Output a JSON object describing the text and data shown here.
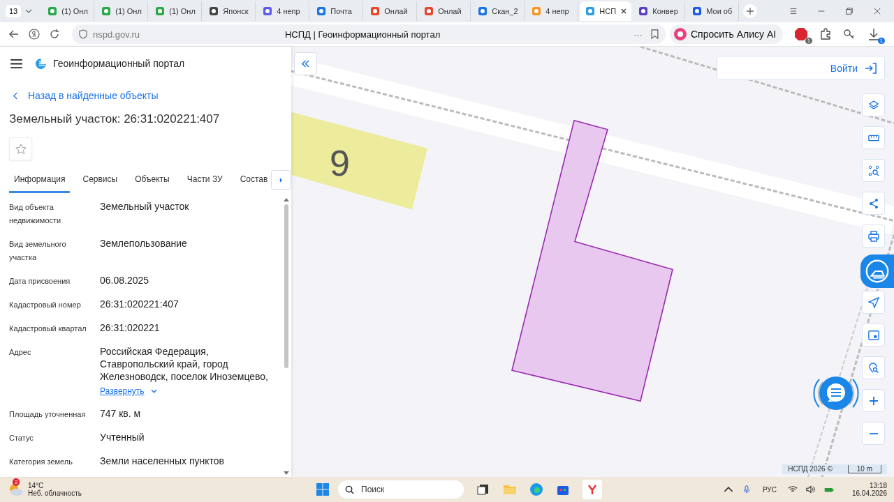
{
  "browser": {
    "tab_count": "13",
    "tabs": [
      {
        "title": "(1) Онл",
        "selected": false
      },
      {
        "title": "(1) Онл",
        "selected": false
      },
      {
        "title": "(1) Онл",
        "selected": false
      },
      {
        "title": "Японск",
        "selected": false
      },
      {
        "title": "4 непр",
        "selected": false
      },
      {
        "title": "Почта",
        "selected": false
      },
      {
        "title": "Онлай",
        "selected": false
      },
      {
        "title": "Онлай",
        "selected": false
      },
      {
        "title": "Скан_2",
        "selected": false
      },
      {
        "title": "4 непр",
        "selected": false
      },
      {
        "title": "НСП",
        "selected": true
      },
      {
        "title": "Конвер",
        "selected": false
      },
      {
        "title": "Мои об",
        "selected": false
      }
    ],
    "address": "nspd.gov.ru",
    "menu_dots": "···",
    "page_title": "НСПД | Геоинформационный портал",
    "alice": "Спросить Алису AI",
    "adblock_badge": "1",
    "download_badge": "1"
  },
  "portal": {
    "title": "Геоинформационный портал",
    "back_link": "Назад в найденные объекты",
    "heading": "Земельный участок: 26:31:020221:407",
    "tabs": [
      {
        "label": "Информация",
        "selected": true
      },
      {
        "label": "Сервисы",
        "selected": false
      },
      {
        "label": "Объекты",
        "selected": false
      },
      {
        "label": "Части ЗУ",
        "selected": false
      },
      {
        "label": "Состав",
        "selected": false
      }
    ],
    "fields": [
      {
        "label": "Вид объекта недвижимости",
        "value": "Земельный участок"
      },
      {
        "label": "Вид земельного участка",
        "value": "Землепользование"
      },
      {
        "label": "Дата присвоения",
        "value": "06.08.2025"
      },
      {
        "label": "Кадастровый номер",
        "value": "26:31:020221:407"
      },
      {
        "label": "Кадастровый квартал",
        "value": "26:31:020221"
      },
      {
        "label": "Адрес",
        "value": "Российская Федерация, Ставропольский край, город Железноводск, поселок Иноземцево,",
        "expand_link": "Развернуть"
      },
      {
        "label": "Площадь уточненная",
        "value": "747 кв. м"
      },
      {
        "label": "Статус",
        "value": "Учтенный"
      },
      {
        "label": "Категория земель",
        "value": "Земли населенных пунктов"
      }
    ]
  },
  "map": {
    "login": "Войти",
    "parcel_label": "9",
    "attribution": "НСПД 2026 ©",
    "scale": "10 m"
  },
  "taskbar": {
    "weather_badge": "2",
    "temperature": "14°C",
    "weather": "Неб. облачность",
    "search_placeholder": "Поиск",
    "language": "РУС",
    "time": "13:18",
    "date": "16.04.2026"
  }
}
